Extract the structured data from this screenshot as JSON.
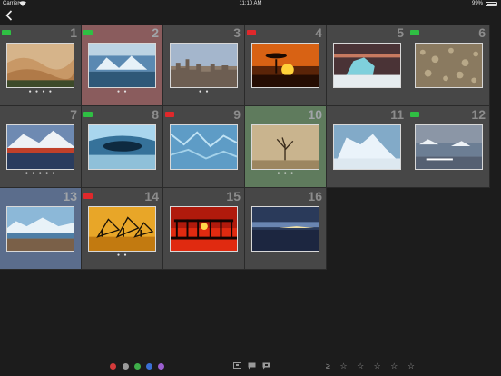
{
  "status_bar": {
    "carrier": "Carrier",
    "time": "11:10 AM",
    "battery": "99%"
  },
  "nav": {
    "back_glyph": "‹",
    "back_icon": "chevron-left-icon"
  },
  "grid": {
    "cells": [
      {
        "number": "1",
        "flag": "green",
        "selection": "none",
        "stars": "● ● ● ●",
        "photo": "desert-dunes"
      },
      {
        "number": "2",
        "flag": "green",
        "selection": "red",
        "stars": "● ●",
        "photo": "icebergs-blue"
      },
      {
        "number": "3",
        "flag": "none",
        "selection": "none",
        "stars": "● ●",
        "photo": "city-skyline"
      },
      {
        "number": "4",
        "flag": "red",
        "selection": "none",
        "stars": "",
        "photo": "acacia-sunset"
      },
      {
        "number": "5",
        "flag": "none",
        "selection": "none",
        "stars": "",
        "photo": "iceberg-sunset"
      },
      {
        "number": "6",
        "flag": "green",
        "selection": "none",
        "stars": "",
        "photo": "rocky-field"
      },
      {
        "number": "7",
        "flag": "none",
        "selection": "none",
        "stars": "● ● ● ● ●",
        "photo": "village-lake"
      },
      {
        "number": "8",
        "flag": "green",
        "selection": "none",
        "stars": "",
        "photo": "ice-cave"
      },
      {
        "number": "9",
        "flag": "red",
        "selection": "none",
        "stars": "",
        "photo": "glacier-ice"
      },
      {
        "number": "10",
        "flag": "none",
        "selection": "green",
        "stars": "● ● ●",
        "photo": "foggy-tree"
      },
      {
        "number": "11",
        "flag": "none",
        "selection": "none",
        "stars": "",
        "photo": "iceberg-blue"
      },
      {
        "number": "12",
        "flag": "green",
        "selection": "none",
        "stars": "",
        "photo": "penguins-ice"
      },
      {
        "number": "13",
        "flag": "none",
        "selection": "blue",
        "stars": "",
        "photo": "ice-shore"
      },
      {
        "number": "14",
        "flag": "red",
        "selection": "none",
        "stars": "● ●",
        "photo": "fishermen"
      },
      {
        "number": "15",
        "flag": "none",
        "selection": "none",
        "stars": "",
        "photo": "red-pier"
      },
      {
        "number": "16",
        "flag": "none",
        "selection": "none",
        "stars": "",
        "photo": "lake-dusk"
      }
    ]
  },
  "bottom_bar": {
    "color_filters": [
      "#d43a3a",
      "#9a9a9a",
      "#3fae4a",
      "#3a6fd4",
      "#9b5fd0"
    ],
    "icons": [
      "flag-filter-icon",
      "comment-filter-icon",
      "flag-comment-icon"
    ],
    "rating_prefix": "≥",
    "rating_stars": [
      "☆",
      "☆",
      "☆",
      "☆",
      "☆"
    ]
  }
}
